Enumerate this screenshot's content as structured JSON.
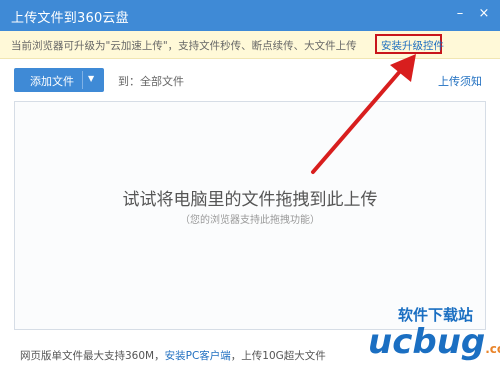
{
  "window": {
    "title": "上传文件到360云盘",
    "minimize_glyph": "–",
    "close_glyph": "×"
  },
  "notice": {
    "text": "当前浏览器可升级为\"云加速上传\"，支持文件秒传、断点续传、大文件上传",
    "install_link": "安装升级控件"
  },
  "toolbar": {
    "add_button": "添加文件",
    "dropdown_glyph": "▼",
    "target": "到：全部文件",
    "help_link": "上传须知"
  },
  "dropzone": {
    "main": "试试将电脑里的文件拖拽到此上传",
    "sub": "（您的浏览器支持此拖拽功能）"
  },
  "footer": {
    "prefix": "网页版单文件最大支持360M，",
    "link": "安装PC客户端",
    "suffix": "，上传10G超大文件"
  },
  "watermark": {
    "text": "软件下载站",
    "logo": "ucbug",
    "suffix": ".com"
  },
  "colors": {
    "titlebar": "#3f8ad6",
    "link": "#1f6fc0",
    "highlight": "#c8151b"
  },
  "icons": {
    "arrow": "red-arrow-icon",
    "minimize": "minimize-icon",
    "close": "close-icon",
    "dropdown": "chevron-down-icon"
  }
}
